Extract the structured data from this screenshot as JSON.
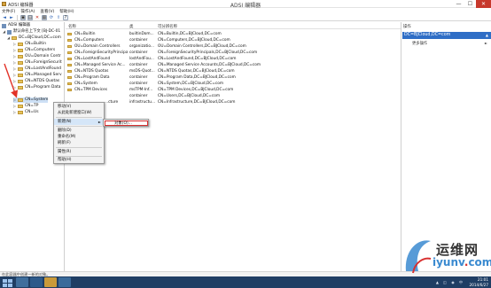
{
  "window": {
    "left_title": "ADSI 编辑器",
    "center_title": "ADSI 编辑器",
    "controls": {
      "minimize": "—",
      "maximize": "☐",
      "close": "✕"
    }
  },
  "menubar": [
    "文件(F)",
    "操作(A)",
    "查看(V)",
    "帮助(H)"
  ],
  "toolbar": {
    "back": "◄",
    "forward": "►",
    "folder": "▣",
    "delete": "✕",
    "props": "▤",
    "refresh": "⟳",
    "export": "⇪",
    "help": "?",
    "view": "▦"
  },
  "tree": {
    "root": "ADSI 编辑器",
    "default_context": "默认命名上下文 [BJ-DC-01",
    "dc_node": "DC=BJCloud,DC=com",
    "children": [
      "CN=Builtin",
      "CN=Computers",
      "OU=Domain Contr",
      "CN=ForeignSecurit",
      "CN=LostAndFound",
      "CN=Managed Serv",
      "CN=NTDS Quotas",
      "CN=Program Data",
      "CN=System",
      "CN=TP",
      "CN=Us"
    ],
    "expanders": {
      "collapsed": "▷",
      "expanded": "◢"
    }
  },
  "list": {
    "headers": {
      "name": "名称",
      "class": "类",
      "dn": "可分辨名称"
    },
    "rows": [
      {
        "name": "CN=Builtin",
        "class": "builtinDom...",
        "dn": "CN=Builtin,DC=BJCloud,DC=com"
      },
      {
        "name": "CN=Computers",
        "class": "container",
        "dn": "CN=Computers,DC=BJCloud,DC=com"
      },
      {
        "name": "OU=Domain Controllers",
        "class": "organizatio...",
        "dn": "OU=Domain Controllers,DC=BJCloud,DC=com"
      },
      {
        "name": "CN=ForeignSecurityPrincipals...",
        "class": "container",
        "dn": "CN=ForeignSecurityPrincipals,DC=BJCloud,DC=com"
      },
      {
        "name": "CN=LostAndFound",
        "class": "lostAndFou...",
        "dn": "CN=LostAndFound,DC=BJCloud,DC=com"
      },
      {
        "name": "CN=Managed Service Ac...",
        "class": "container",
        "dn": "CN=Managed Service Accounts,DC=BJCloud,DC=com"
      },
      {
        "name": "CN=NTDS Quotas",
        "class": "msDS-Quot...",
        "dn": "CN=NTDS Quotas,DC=BJCloud,DC=com"
      },
      {
        "name": "CN=Program Data",
        "class": "container",
        "dn": "CN=Program Data,DC=BJCloud,DC=com"
      },
      {
        "name": "CN=System",
        "class": "container",
        "dn": "CN=System,DC=BJCloud,DC=com"
      },
      {
        "name": "CN=TPM Devices",
        "class": "msTPM-Inf...",
        "dn": "CN=TPM Devices,DC=BJCloud,DC=com"
      },
      {
        "name": "",
        "class": "container",
        "dn": "CN=Users,DC=BJCloud,DC=com"
      },
      {
        "name": "...cture",
        "class": "infrastructu...",
        "dn": "CN=Infrastructure,DC=BJCloud,DC=com"
      }
    ]
  },
  "actions": {
    "header": "操作",
    "section": "DC=BJCloud,DC=com",
    "section_arrow": "▲",
    "more": "更多操作",
    "more_arrow": "►"
  },
  "context_menu": {
    "items": [
      "移动(V)",
      "从此处新建窗口(W)",
      "新建(N)",
      "删除(D)",
      "重命名(M)",
      "刷新(F)",
      "属性(R)",
      "帮助(H)"
    ],
    "submenu_arrow": "►"
  },
  "submenu": {
    "item": "对象(O)..."
  },
  "statusbar": {
    "text": "在此容器中创建一新的对象。"
  },
  "taskbar": {
    "tray": "▲ ◫ ◉ 中",
    "time": "21:01",
    "date": "2014/6/27"
  },
  "watermark": {
    "cn": "运维网",
    "url_left": "iyunv",
    "url_dot": ".",
    "url_right": "com"
  }
}
